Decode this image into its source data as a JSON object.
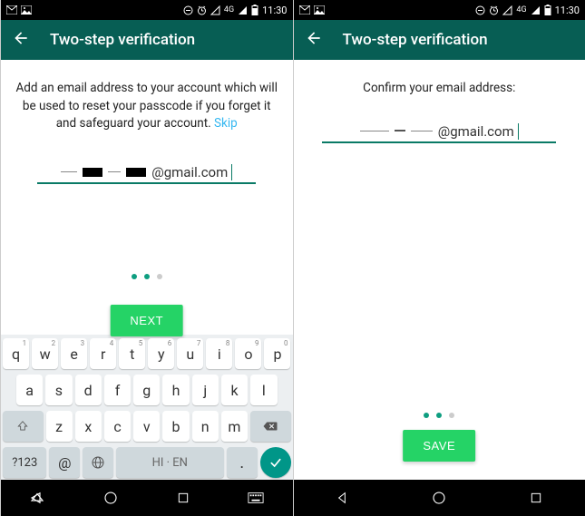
{
  "status": {
    "time": "11:30",
    "network": "4G",
    "icons_left_p1": [
      "gmail-icon",
      "picture-icon"
    ],
    "icons_left_p2": [
      "gmail-icon",
      "picture-icon"
    ],
    "icons_right": [
      "dnd-icon",
      "alarm-icon",
      "signal-triangle-icon",
      "network-4g",
      "signal-icon",
      "battery-icon"
    ]
  },
  "appbar": {
    "title": "Two-step verification"
  },
  "screen1": {
    "instruction": "Add an email address to your account which will be used to reset your passcode if you forget it and safeguard your account.",
    "skip": "Skip",
    "email_suffix": "@gmail.com",
    "button": "NEXT",
    "dots": {
      "total": 3,
      "active_index": 1
    }
  },
  "screen2": {
    "instruction": "Confirm your email address:",
    "email_suffix": "@gmail.com",
    "button": "SAVE",
    "dots": {
      "total": 3,
      "active_index": 1
    }
  },
  "keyboard": {
    "row1": [
      {
        "c": "q",
        "n": "1"
      },
      {
        "c": "w",
        "n": "2"
      },
      {
        "c": "e",
        "n": "3"
      },
      {
        "c": "r",
        "n": "4"
      },
      {
        "c": "t",
        "n": "5"
      },
      {
        "c": "y",
        "n": "6"
      },
      {
        "c": "u",
        "n": "7"
      },
      {
        "c": "i",
        "n": "8"
      },
      {
        "c": "o",
        "n": "9"
      },
      {
        "c": "p",
        "n": "0"
      }
    ],
    "row2": [
      "a",
      "s",
      "d",
      "f",
      "g",
      "h",
      "j",
      "k",
      "l"
    ],
    "row3": [
      "z",
      "x",
      "c",
      "v",
      "b",
      "n",
      "m"
    ],
    "symbols": "?123",
    "at": "@",
    "space_label": "HI · EN",
    "period": "."
  }
}
